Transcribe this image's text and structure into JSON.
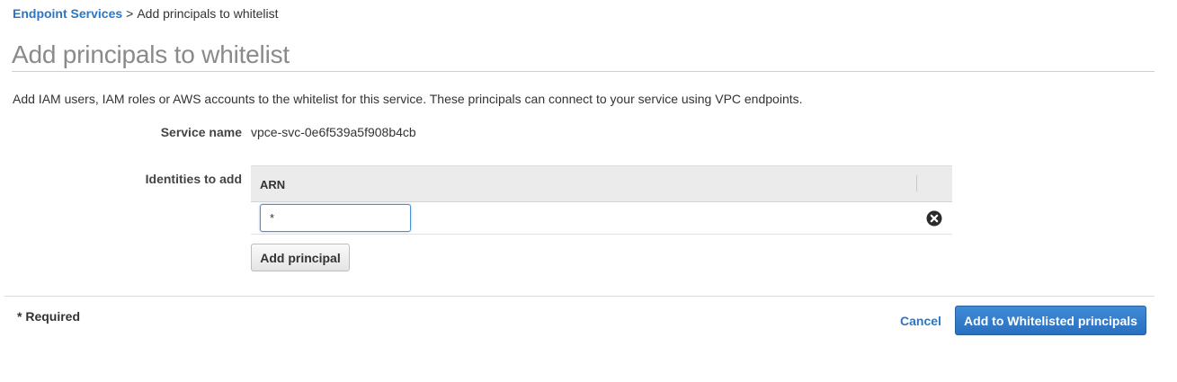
{
  "breadcrumb": {
    "parent": "Endpoint Services",
    "separator": ">",
    "current": "Add principals to whitelist"
  },
  "page": {
    "title": "Add principals to whitelist",
    "description": "Add IAM users, IAM roles or AWS accounts to the whitelist for this service. These principals can connect to your service using VPC endpoints."
  },
  "form": {
    "service_name_label": "Service name",
    "service_name_value": "vpce-svc-0e6f539a5f908b4cb",
    "identities_label": "Identities to add",
    "arn_column_header": "ARN",
    "arn_rows": [
      {
        "value": "*"
      }
    ],
    "add_principal_label": "Add principal",
    "remove_icon": "close-circle-icon"
  },
  "footer": {
    "required_note": "* Required",
    "cancel_label": "Cancel",
    "submit_label": "Add to Whitelisted principals"
  },
  "colors": {
    "link": "#2b77c5",
    "primary_button": "#2f79c9",
    "title": "#8a8a8a",
    "table_header": "#ebebeb"
  }
}
